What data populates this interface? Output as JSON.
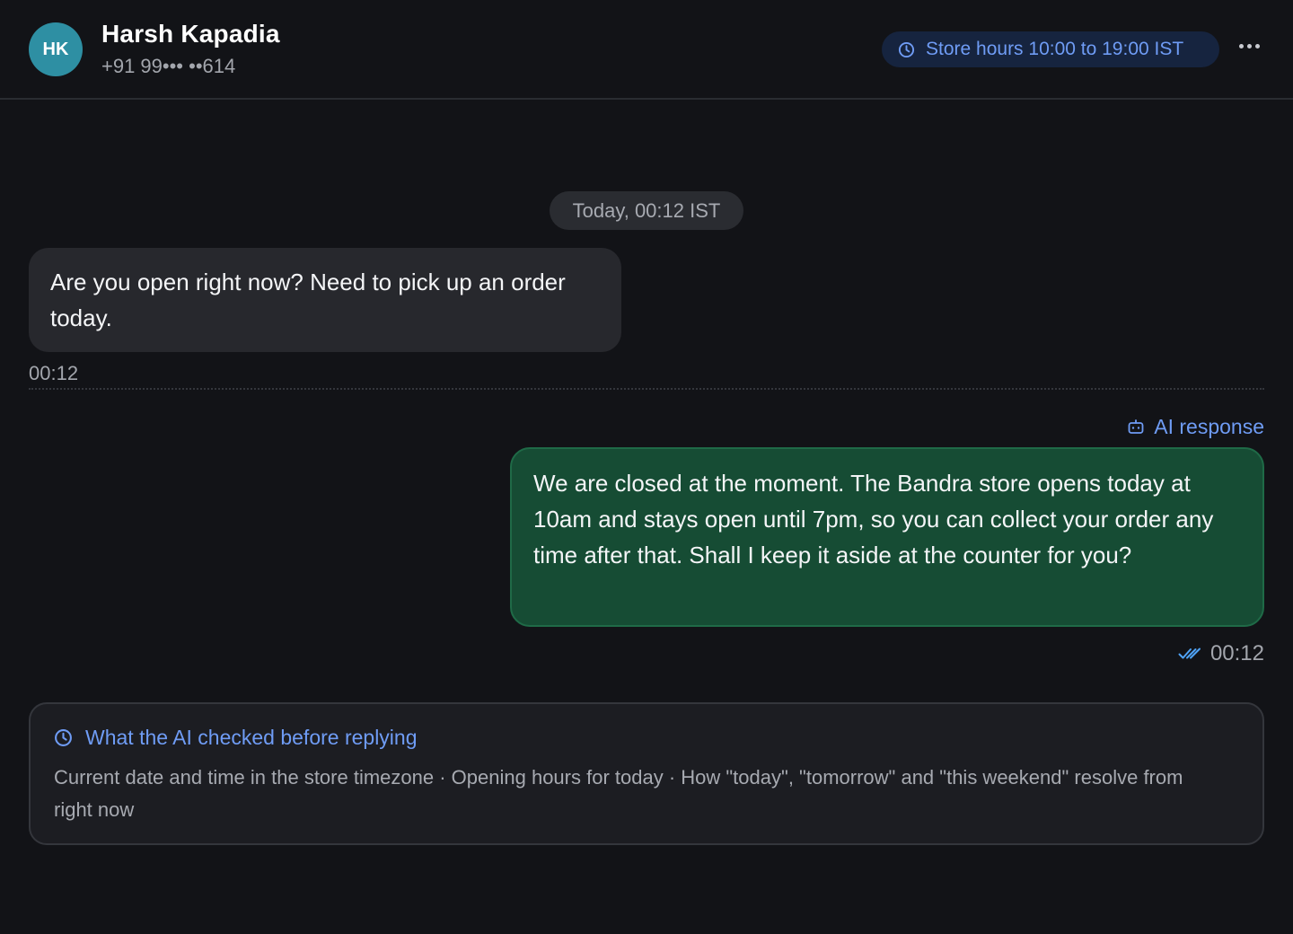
{
  "header": {
    "avatar_initials": "HK",
    "contact_name": "Harsh Kapadia",
    "contact_phone": "+91 99••• ••614",
    "store_hours": "Store hours 10:00 to 19:00 IST"
  },
  "chat": {
    "date_separator": "Today, 00:12 IST",
    "incoming": {
      "text": "Are you open right now? Need to pick up an order today.",
      "time": "00:12"
    },
    "outgoing": {
      "label": "AI response",
      "text": "We are closed at the moment. The Bandra store opens today at 10am and stays open until 7pm, so you can collect your order any time after that. Shall I keep it aside at the counter for you?",
      "time": "00:12",
      "status": "read"
    }
  },
  "ai_check": {
    "title": "What the AI checked before replying",
    "body": "Current date and time in the store timezone · Opening hours for today · How \"today\", \"tomorrow\" and \"this weekend\" resolve from right now"
  },
  "icons": {
    "hours": "clock-icon",
    "more": "more-horizontal-icon",
    "ai": "bot-icon",
    "status": "double-check-icon",
    "check": "clock-icon"
  },
  "colors": {
    "background": "#121317",
    "accent": "#6f9cf5",
    "avatar": "#2e8fa3",
    "incoming_bubble": "#27282d",
    "outgoing_bubble": "#164c34"
  }
}
